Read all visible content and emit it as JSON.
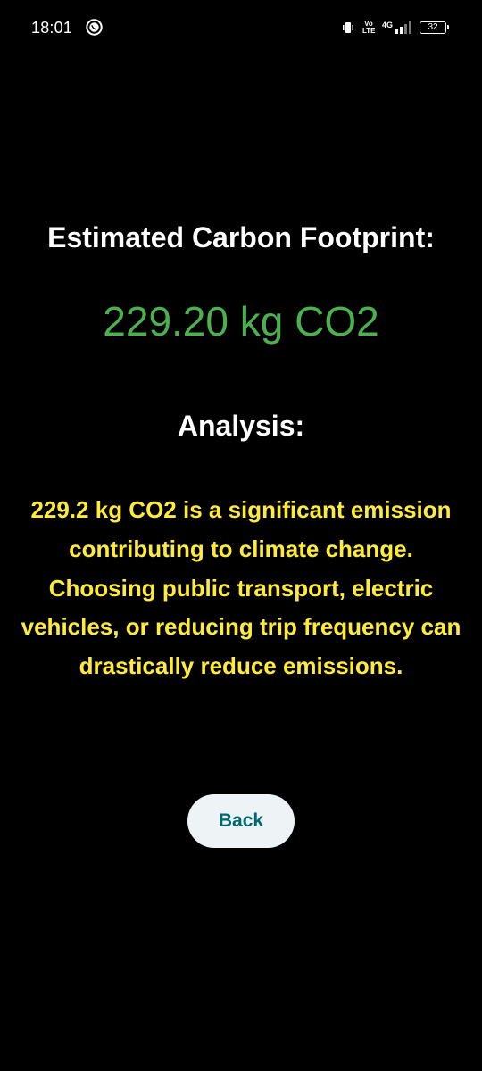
{
  "status_bar": {
    "time": "18:01",
    "app_icon": "whatsapp-icon",
    "vibrate_icon": "vibrate-icon",
    "volte": "Vo LTE",
    "network": "4G",
    "signal_icon": "signal-icon",
    "battery": "32"
  },
  "main": {
    "title": "Estimated Carbon Footprint:",
    "value": "229.20 kg CO2",
    "analysis_heading": "Analysis:",
    "analysis_text": "229.2 kg CO2 is a significant emission contributing to climate change. Choosing public transport, electric vehicles, or reducing trip frequency can drastically reduce emissions.",
    "back_label": "Back"
  },
  "colors": {
    "background": "#000000",
    "value": "#4caf50",
    "analysis_text": "#ffeb3b",
    "button_bg": "#eef4f6",
    "button_text": "#00696d"
  }
}
